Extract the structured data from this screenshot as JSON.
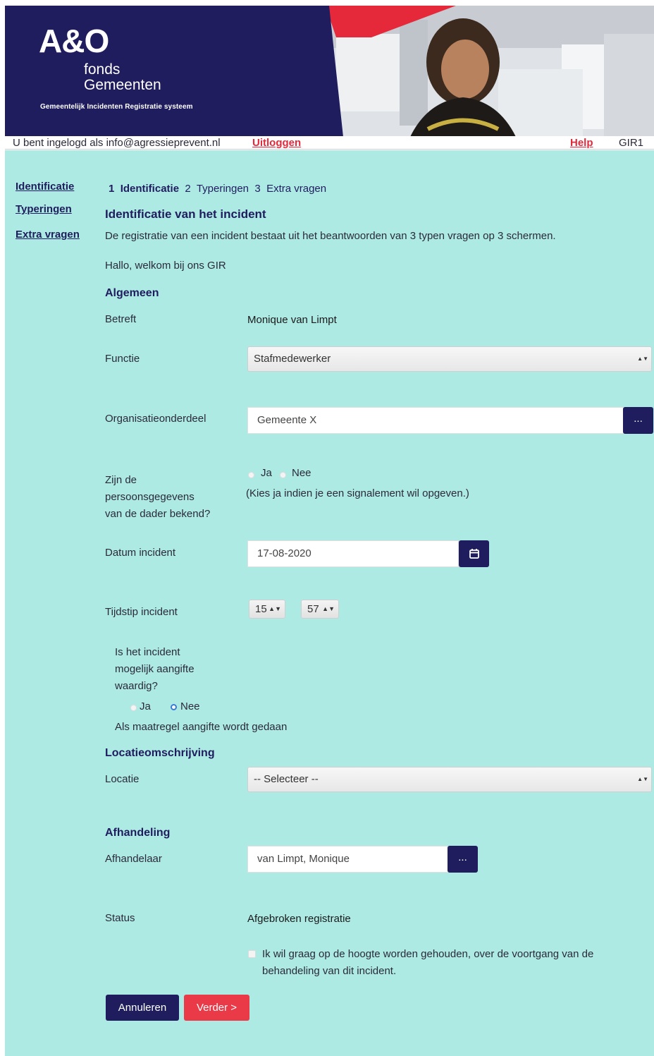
{
  "header": {
    "logo_mark": "A&O",
    "logo_line1": "fonds",
    "logo_line2": "Gemeenten",
    "logo_subtitle": "Gemeentelijk Incidenten Registratie systeem"
  },
  "userbar": {
    "logged_in_text": "U bent ingelogd als info@agressieprevent.nl",
    "logout_label": "Uitloggen",
    "help_label": "Help",
    "system_code": "GIR1"
  },
  "sidenav": {
    "items": [
      {
        "label": "Identificatie"
      },
      {
        "label": "Typeringen"
      },
      {
        "label": "Extra vragen"
      }
    ]
  },
  "steps": {
    "step1_num": "1",
    "step1_label": "Identificatie",
    "step2_num": "2",
    "step2_label": "Typeringen",
    "step3_num": "3",
    "step3_label": "Extra vragen"
  },
  "page": {
    "title": "Identificatie van het incident",
    "intro": "De registratie van een incident bestaat uit het beantwoorden van 3 typen vragen op 3 schermen.",
    "welcome": "Hallo, welkom bij ons GIR"
  },
  "algemeen": {
    "heading": "Algemeen",
    "betreft_label": "Betreft",
    "betreft_value": "Monique van Limpt",
    "functie_label": "Functie",
    "functie_value": "Stafmedewerker",
    "org_label": "Organisatieonderdeel",
    "org_value": "Gemeente X",
    "org_button": "...",
    "dader_label_l1": "Zijn de",
    "dader_label_l2": "persoonsgegevens",
    "dader_label_l3": "van de dader bekend?",
    "dader_ja": "Ja",
    "dader_nee": "Nee",
    "dader_hint": "(Kies ja indien je een signalement wil opgeven.)",
    "datum_label": "Datum incident",
    "datum_value": "17-08-2020",
    "tijd_label": "Tijdstip incident",
    "tijd_hour": "15",
    "tijd_minute": "57",
    "aangifte_l1": "Is het incident",
    "aangifte_l2": "mogelijk aangifte",
    "aangifte_l3": "waardig?",
    "aangifte_ja": "Ja",
    "aangifte_nee": "Nee",
    "aangifte_selected": "Nee",
    "maatregel_text": "Als maatregel aangifte wordt gedaan"
  },
  "locatie": {
    "heading": "Locatieomschrijving",
    "label": "Locatie",
    "value": "-- Selecteer --"
  },
  "afhandeling": {
    "heading": "Afhandeling",
    "afhandelaar_label": "Afhandelaar",
    "afhandelaar_value": "van Limpt, Monique",
    "afhandelaar_button": "...",
    "status_label": "Status",
    "status_value": "Afgebroken registratie",
    "checkbox_l1": "Ik wil graag op de hoogte worden gehouden, over de voortgang van de",
    "checkbox_l2": "behandeling van dit incident."
  },
  "buttons": {
    "cancel": "Annuleren",
    "next": "Verder >"
  },
  "colors": {
    "navy": "#1f1d5e",
    "red": "#ea3a48",
    "background": "#aeeae4"
  }
}
